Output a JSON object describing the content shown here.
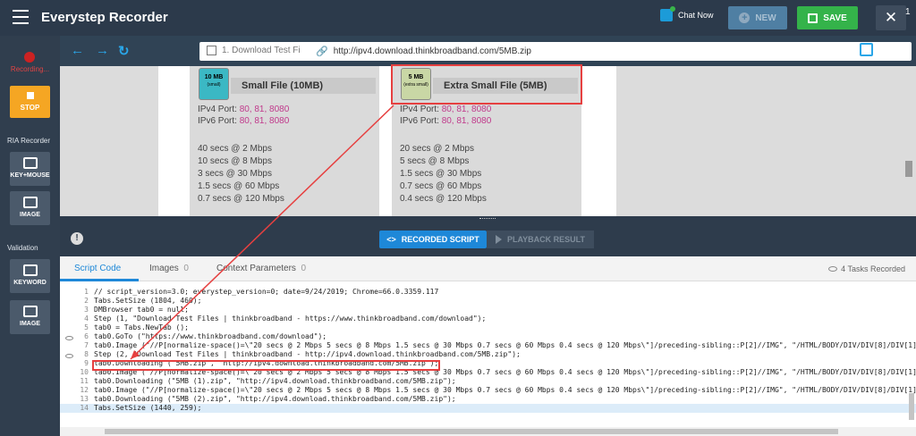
{
  "app": {
    "title": "Everystep Recorder"
  },
  "header": {
    "chat_label": "Chat Now",
    "new_label": "NEW",
    "save_label": "SAVE",
    "close_symbol": "✕"
  },
  "sidebar": {
    "status": "Recording...",
    "stop_label": "STOP",
    "ria_section": "RIA Recorder",
    "key_mouse_label": "KEY+MOUSE",
    "image_label": "IMAGE",
    "validation_section": "Validation",
    "keyword_label": "KEYWORD",
    "image2_label": "IMAGE"
  },
  "browser": {
    "tab_title": "1. Download Test Fi",
    "url": "http://ipv4.download.thinkbroadband.com/5MB.zip",
    "tab_count": "1"
  },
  "page": {
    "cards": [
      {
        "icon_size": "10 MB",
        "icon_sub": "(small)",
        "icon_color": "#3bb8c4",
        "title": "Small File (10MB)",
        "ipv4_label": "IPv4 Port:",
        "ipv4_ports": "80, 81, 8080",
        "ipv6_label": "IPv6 Port:",
        "ipv6_ports": "80, 81, 8080",
        "speeds": [
          "40 secs @ 2 Mbps",
          "10 secs @ 8 Mbps",
          "3 secs @ 30 Mbps",
          "1.5 secs @ 60 Mbps",
          "0.7 secs @ 120 Mbps"
        ]
      },
      {
        "icon_size": "5 MB",
        "icon_sub": "(extra small)",
        "icon_color": "#c9d7a5",
        "title": "Extra Small File (5MB)",
        "ipv4_label": "IPv4 Port:",
        "ipv4_ports": "80, 81, 8080",
        "ipv6_label": "IPv6 Port:",
        "ipv6_ports": "80, 81, 8080",
        "speeds": [
          "20 secs @ 2 Mbps",
          "5 secs @ 8 Mbps",
          "1.5 secs @ 30 Mbps",
          "0.7 secs @ 60 Mbps",
          "0.4 secs @ 120 Mbps"
        ]
      }
    ]
  },
  "playbar": {
    "recorded_label": "RECORDED SCRIPT",
    "playback_label": "PLAYBACK RESULT",
    "info_symbol": "!"
  },
  "tabs": {
    "script_code": "Script Code",
    "images": "Images",
    "images_count": "0",
    "context": "Context Parameters",
    "context_count": "0",
    "tasks": "4 Tasks Recorded"
  },
  "code": {
    "lines": [
      {
        "n": "1",
        "text": "// script_version=3.0; everystep_version=0; date=9/24/2019; Chrome=66.0.3359.117"
      },
      {
        "n": "2",
        "text": "Tabs.SetSize (1804, 460);"
      },
      {
        "n": "3",
        "text": "DMBrowser tab0 = null;"
      },
      {
        "n": "4",
        "text": "Step (1, \"Download Test Files | thinkbroadband - https://www.thinkbroadband.com/download\");"
      },
      {
        "n": "5",
        "text": "tab0 = Tabs.NewTab ();"
      },
      {
        "n": "6",
        "text": "tab0.GoTo (\"https://www.thinkbroadband.com/download\");"
      },
      {
        "n": "7",
        "text": "tab0.Image (\"//P[normalize-space()=\\\"20 secs @ 2 Mbps 5 secs @ 8 Mbps 1.5 secs @ 30 Mbps 0.7 secs @ 60 Mbps 0.4 secs @ 120 Mbps\\\"]/preceding-sibling::P[2]//IMG\", \"/HTML/BODY/DIV/DIV[8]/DIV[1]/D"
      },
      {
        "n": "8",
        "text": "Step (2, \"Download Test Files | thinkbroadband - http://ipv4.download.thinkbroadband.com/5MB.zip\");"
      },
      {
        "n": "9",
        "text": "tab0.Downloading (\"5MB.zip\", \"http://ipv4.download.thinkbroadband.com/5MB.zip\");"
      },
      {
        "n": "10",
        "text": "tab0.Image (\"//P[normalize-space()=\\\"20 secs @ 2 Mbps 5 secs @ 8 Mbps 1.5 secs @ 30 Mbps 0.7 secs @ 60 Mbps 0.4 secs @ 120 Mbps\\\"]/preceding-sibling::P[2]//IMG\", \"/HTML/BODY/DIV/DIV[8]/DIV[1]/D"
      },
      {
        "n": "11",
        "text": "tab0.Downloading (\"5MB (1).zip\", \"http://ipv4.download.thinkbroadband.com/5MB.zip\");"
      },
      {
        "n": "12",
        "text": "tab0.Image (\"//P[normalize-space()=\\\"20 secs @ 2 Mbps 5 secs @ 8 Mbps 1.5 secs @ 30 Mbps 0.7 secs @ 60 Mbps 0.4 secs @ 120 Mbps\\\"]/preceding-sibling::P[2]//IMG\", \"/HTML/BODY/DIV/DIV[8]/DIV[1]/D"
      },
      {
        "n": "13",
        "text": "tab0.Downloading (\"5MB (2).zip\", \"http://ipv4.download.thinkbroadband.com/5MB.zip\");"
      },
      {
        "n": "14",
        "text": "Tabs.SetSize (1440, 259);"
      }
    ]
  },
  "colors": {
    "accent": "#1e88d8",
    "save": "#34b34a",
    "highlight": "#e64040",
    "stop": "#f5a623"
  }
}
